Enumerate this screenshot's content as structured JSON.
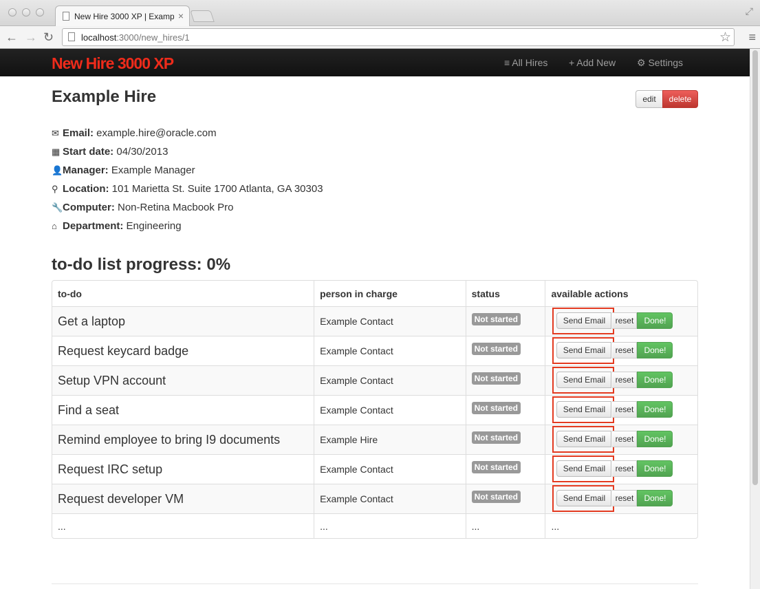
{
  "browser": {
    "tab_title": "New Hire 3000 XP | Example Hire",
    "tab_close": "×",
    "url_host": "localhost",
    "url_path": ":3000/new_hires/1",
    "back_icon": "←",
    "forward_icon": "→",
    "reload_icon": "↻",
    "star_icon": "☆",
    "menu_icon": "≡",
    "fullscreen_icon": "⤢"
  },
  "navbar": {
    "brand": "New Hire 3000 XP",
    "links": [
      {
        "label": "≡ All Hires"
      },
      {
        "label": "+ Add New"
      },
      {
        "label": "⚙ Settings"
      }
    ]
  },
  "hire": {
    "title": "Example Hire",
    "edit_label": "edit",
    "delete_label": "delete",
    "details": [
      {
        "icon": "✉",
        "icon_name": "envelope-icon",
        "label": "Email:",
        "value": " example.hire@oracle.com"
      },
      {
        "icon": "▦",
        "icon_name": "calendar-icon",
        "label": "Start date:",
        "value": " 04/30/2013"
      },
      {
        "icon": "👤",
        "icon_name": "user-icon",
        "label": "Manager:",
        "value": " Example Manager"
      },
      {
        "icon": "⚲",
        "icon_name": "map-marker-icon",
        "label": "Location:",
        "value": " 101 Marietta St. Suite 1700 Atlanta, GA 30303"
      },
      {
        "icon": "🔧",
        "icon_name": "wrench-icon",
        "label": "Computer:",
        "value": " Non-Retina Macbook Pro"
      },
      {
        "icon": "⌂",
        "icon_name": "home-icon",
        "label": "Department:",
        "value": " Engineering"
      }
    ]
  },
  "progress_heading": "to-do list progress: 0%",
  "table": {
    "headers": [
      "to-do",
      "person in charge",
      "status",
      "available actions"
    ],
    "rows": [
      {
        "task": "Get a laptop",
        "person": "Example Contact",
        "status": "Not started"
      },
      {
        "task": "Request keycard badge",
        "person": "Example Contact",
        "status": "Not started"
      },
      {
        "task": "Setup VPN account",
        "person": "Example Contact",
        "status": "Not started"
      },
      {
        "task": "Find a seat",
        "person": "Example Contact",
        "status": "Not started"
      },
      {
        "task": "Remind employee to bring I9 documents",
        "person": "Example Hire",
        "status": "Not started"
      },
      {
        "task": "Request IRC setup",
        "person": "Example Contact",
        "status": "Not started"
      },
      {
        "task": "Request developer VM",
        "person": "Example Contact",
        "status": "Not started"
      }
    ],
    "actions": {
      "send": "Send Email",
      "reset": "reset",
      "done": "Done!"
    },
    "ellipsis": "..."
  }
}
